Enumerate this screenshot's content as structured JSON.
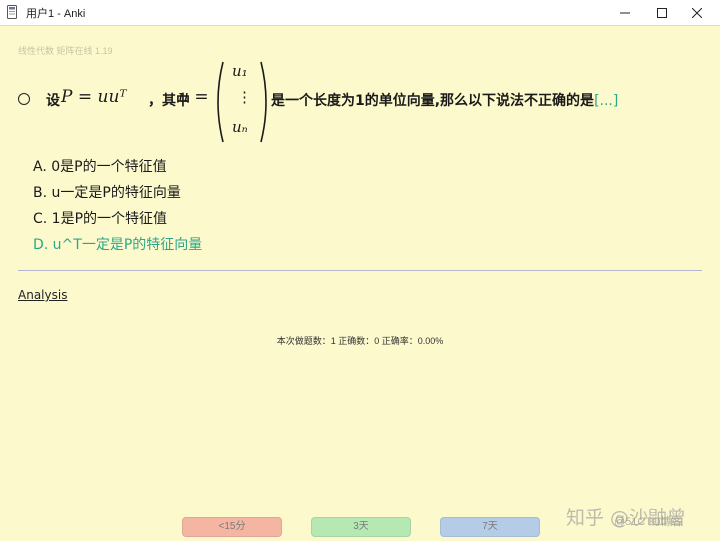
{
  "window": {
    "title": "用户1 - Anki",
    "icons": {
      "app": "anki-app-icon",
      "minimize": "minimize-icon",
      "maximize": "maximize-icon",
      "close": "close-icon"
    }
  },
  "card": {
    "deck_info": "线性代数 矩阵在线 1.19",
    "question": {
      "lead": "设",
      "math_eq1": "P = uuᵀ",
      "mid": "，其中",
      "math_eq2": "u =",
      "matrix": {
        "top": "u₁",
        "middle": "⋮",
        "bottom": "uₙ"
      },
      "tail": "是一个长度为1的单位向量,那么以下说法不正确的是",
      "cloze": "[...]"
    },
    "options": [
      {
        "label": "A. 0是P的一个特征值",
        "correct": false
      },
      {
        "label": "B. u一定是P的特征向量",
        "correct": false
      },
      {
        "label": "C. 1是P的一个特征值",
        "correct": false
      },
      {
        "label": "D. u^T一定是P的特征向量",
        "correct": true
      }
    ],
    "analysis_link": "Analysis",
    "stats": "本次做题数：1 正确数：0 正确率：0.00%"
  },
  "answer_buttons": [
    {
      "label": "<15分",
      "color": "#f4b5a3"
    },
    {
      "label": "3天",
      "color": "#b5e8b3"
    },
    {
      "label": "7天",
      "color": "#b4cce6"
    }
  ],
  "watermark": {
    "main": "知乎 @沙鼬曾",
    "sub": "@51CTO博客"
  },
  "colors": {
    "background": "#fcfacd",
    "accent_green": "#2ca68a"
  }
}
